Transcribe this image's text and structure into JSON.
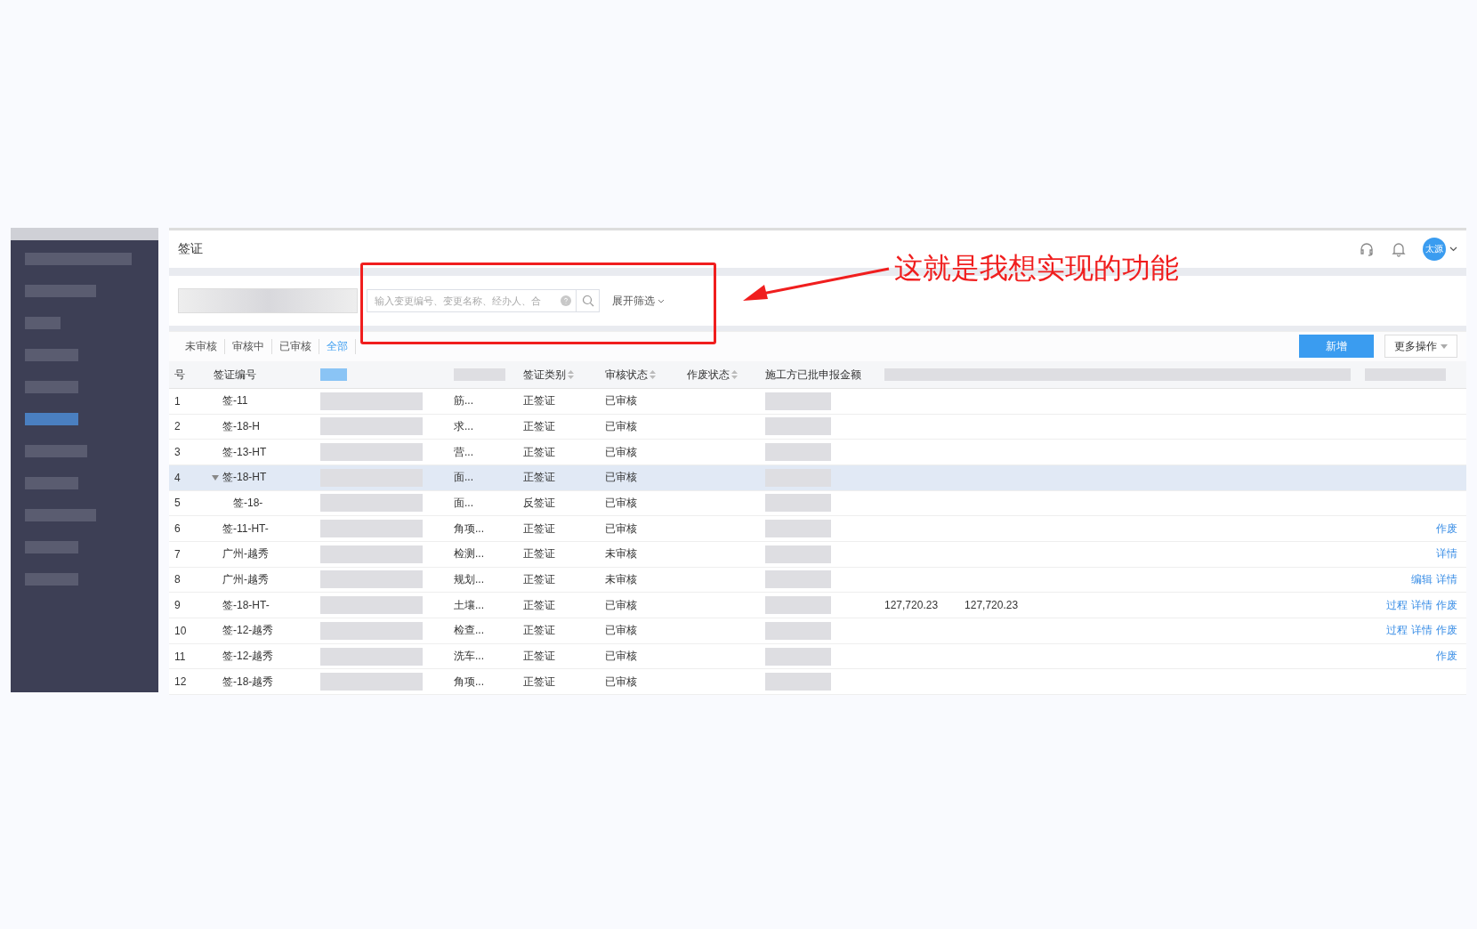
{
  "header": {
    "title": "签证",
    "avatar": "太源"
  },
  "filter": {
    "placeholder": "输入变更编号、变更名称、经办人、合",
    "expand": "展开筛选"
  },
  "tabs": [
    {
      "label": "未审核",
      "selected": false
    },
    {
      "label": "审核中",
      "selected": false
    },
    {
      "label": "已审核",
      "selected": false
    },
    {
      "label": "全部",
      "selected": true
    }
  ],
  "buttons": {
    "add": "新增",
    "more": "更多操作"
  },
  "table": {
    "columns": [
      {
        "label": "号",
        "sortable": false
      },
      {
        "label": "签证编号",
        "sortable": false
      },
      {
        "label": "签证类别",
        "sortable": true
      },
      {
        "label": "审核状态",
        "sortable": true
      },
      {
        "label": "作废状态",
        "sortable": true
      },
      {
        "label": "施工方已批申报金额",
        "sortable": false
      }
    ],
    "rows": [
      {
        "no": "1",
        "code": "签-11",
        "name": "筋...",
        "type": "正签证",
        "status": "已审核",
        "selected": false
      },
      {
        "no": "2",
        "code": "签-18-H",
        "name": "求...",
        "type": "正签证",
        "status": "已审核",
        "selected": false
      },
      {
        "no": "3",
        "code": "签-13-HT",
        "name": "营...",
        "type": "正签证",
        "status": "已审核",
        "selected": false
      },
      {
        "no": "4",
        "code": "签-18-HT",
        "name": "面...",
        "type": "正签证",
        "status": "已审核",
        "selected": true,
        "expanded": true,
        "children": [
          {
            "no": "5",
            "code": "签-18-",
            "name": "面...",
            "type": "反签证",
            "status": "已审核",
            "selected": false
          }
        ]
      },
      {
        "no": "6",
        "code": "签-11-HT-",
        "name": "角项...",
        "type": "正签证",
        "status": "已审核",
        "selected": false,
        "actions": [
          "作废"
        ]
      },
      {
        "no": "7",
        "code": "广州-越秀",
        "name": "检测...",
        "type": "正签证",
        "status": "未审核",
        "selected": false,
        "actions": [
          "详情"
        ]
      },
      {
        "no": "8",
        "code": "广州-越秀",
        "name": "规划...",
        "type": "正签证",
        "status": "未审核",
        "selected": false,
        "actions": [
          "编辑",
          "详情"
        ]
      },
      {
        "no": "9",
        "code": "签-18-HT-",
        "name": "土壤...",
        "type": "正签证",
        "status": "已审核",
        "selected": false,
        "amounts": [
          "127,720.23",
          "127,720.23"
        ],
        "actions": [
          "过程",
          "详情",
          "作废"
        ]
      },
      {
        "no": "10",
        "code": "签-12-越秀",
        "name": "检查...",
        "type": "正签证",
        "status": "已审核",
        "selected": false,
        "actions": [
          "过程",
          "详情",
          "作废"
        ]
      },
      {
        "no": "11",
        "code": "签-12-越秀",
        "name": "洗车...",
        "type": "正签证",
        "status": "已审核",
        "selected": false,
        "actions": [
          "作废"
        ]
      },
      {
        "no": "12",
        "code": "签-18-越秀",
        "name": "角项...",
        "type": "正签证",
        "status": "已审核",
        "selected": false
      }
    ]
  },
  "annotation": {
    "text": "这就是我想实现的功能"
  }
}
